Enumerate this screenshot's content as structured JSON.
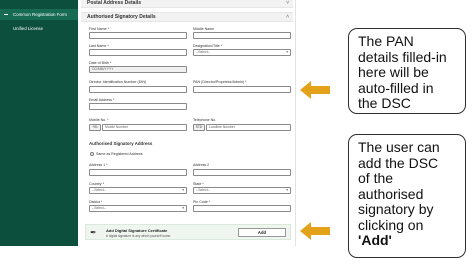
{
  "sidebar": {
    "items": [
      {
        "label": "Common Registration Form",
        "active": true
      },
      {
        "label": "Unified License",
        "active": false
      }
    ]
  },
  "sections": {
    "postal": "Postal Address Details",
    "authorised": "Authorised Signatory Details"
  },
  "fields": {
    "first_name": {
      "label": "First Name *"
    },
    "middle_name": {
      "label": "Middle Name"
    },
    "last_name": {
      "label": "Last Name *"
    },
    "designation": {
      "label": "Designation/Title *",
      "value": "--Select--"
    },
    "dob": {
      "label": "Date of Birth *",
      "value": "DD/MM/YYYY"
    },
    "din": {
      "label": "Director Identification Number (DIN)"
    },
    "pan": {
      "label": "PAN (Director/Proprietor/Admin) *"
    },
    "email": {
      "label": "Email Address *"
    },
    "mobile": {
      "label": "Mobile No. *",
      "prefix": "+91",
      "placeholder": "Mobile Number"
    },
    "telephone": {
      "label": "Telephone No.",
      "prefix": "STD",
      "placeholder": "Landline Number"
    },
    "address_heading": "Authorised Signatory Address",
    "same_as_registered": "Same as Registered Address",
    "address1": {
      "label": "Address 1 *"
    },
    "address2": {
      "label": "Address 2"
    },
    "country": {
      "label": "Country *",
      "value": "--Select--"
    },
    "state": {
      "label": "State *",
      "value": "--Select--"
    },
    "district": {
      "label": "District *",
      "value": "--Select--"
    },
    "pin": {
      "label": "Pin Code *"
    }
  },
  "dsc": {
    "title": "Add Digital Signature Certificate",
    "subtitle": "A digital signature is any which yourself some.",
    "button": "Add"
  },
  "callouts": {
    "top": [
      "The PAN",
      "details filled-in",
      "here will be",
      "auto-filled in",
      "the DSC"
    ],
    "bottom": [
      "The user can",
      "add the DSC",
      "of the",
      "authorised",
      "signatory by",
      "clicking on",
      "'Add'"
    ]
  },
  "colors": {
    "sidebar": "#0c4f3c",
    "arrow": "#e3a21a",
    "dsc_box": "#eef6ef"
  },
  "icons": {
    "dsc": "pen-signature-icon",
    "arrow": "left-arrow-icon"
  }
}
